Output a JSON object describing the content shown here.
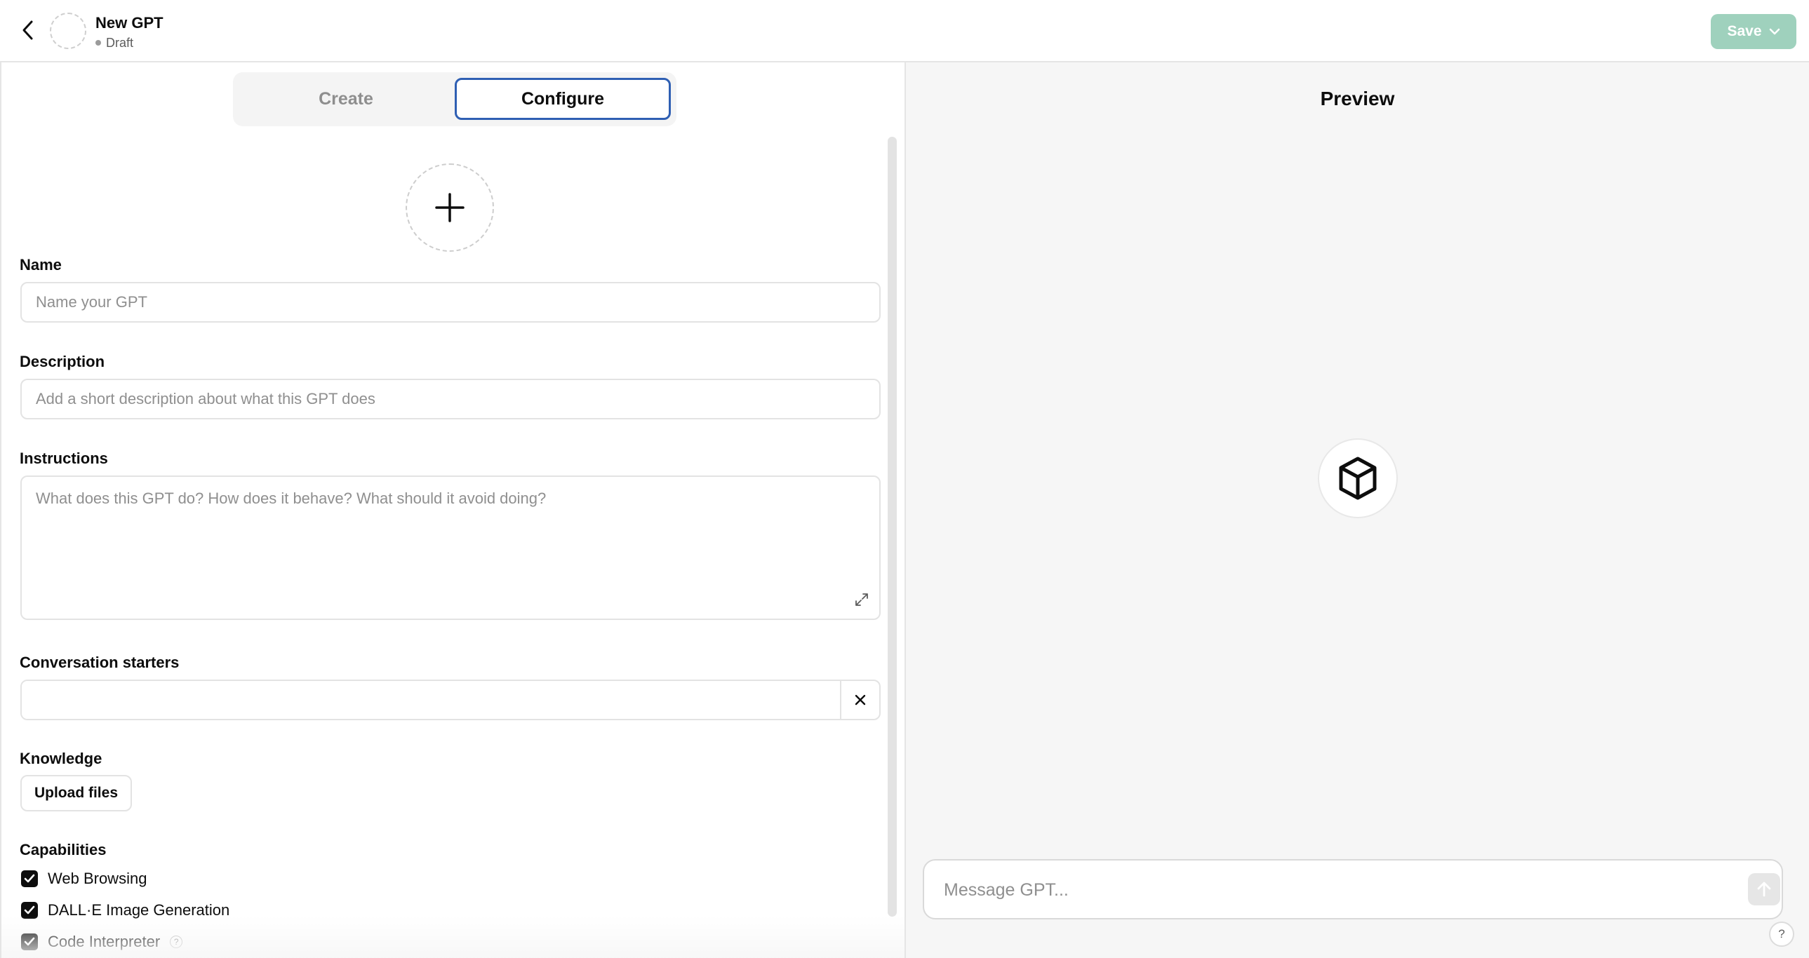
{
  "header": {
    "title": "New GPT",
    "status": "Draft",
    "save_label": "Save"
  },
  "tabs": [
    {
      "label": "Create",
      "active": false
    },
    {
      "label": "Configure",
      "active": true
    }
  ],
  "form": {
    "name": {
      "label": "Name",
      "placeholder": "Name your GPT",
      "value": ""
    },
    "description": {
      "label": "Description",
      "placeholder": "Add a short description about what this GPT does",
      "value": ""
    },
    "instructions": {
      "label": "Instructions",
      "placeholder": "What does this GPT do? How does it behave? What should it avoid doing?",
      "value": ""
    },
    "conversation_starters": {
      "label": "Conversation starters",
      "value": ""
    },
    "knowledge": {
      "label": "Knowledge",
      "upload_label": "Upload files"
    },
    "capabilities": {
      "label": "Capabilities",
      "items": [
        {
          "label": "Web Browsing",
          "checked": true
        },
        {
          "label": "DALL·E Image Generation",
          "checked": true
        },
        {
          "label": "Code Interpreter",
          "checked": true,
          "help": "?"
        }
      ]
    }
  },
  "preview": {
    "title": "Preview",
    "message_placeholder": "Message GPT...",
    "help_label": "?"
  },
  "colors": {
    "save_button": "#9fd1bd",
    "configure_tab_border": "#2f5fb3",
    "preview_background": "#f6f6f6"
  },
  "icons": {
    "back": "chevron-left-icon",
    "add_avatar": "plus-icon",
    "expand": "expand-icon",
    "remove_starter": "close-icon",
    "preview_avatar": "cube-icon",
    "send": "arrow-up-icon",
    "save_dropdown": "chevron-down-icon"
  }
}
